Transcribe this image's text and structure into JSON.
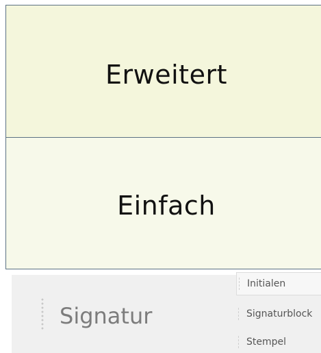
{
  "cards": {
    "advanced_label": "Erweitert",
    "simple_label": "Einfach"
  },
  "signature_panel": {
    "label": "Signatur",
    "menu": {
      "items": [
        "Initialen",
        "Signaturblock",
        "Stempel"
      ]
    }
  },
  "colors": {
    "advanced_bg": "#f4f6dc",
    "simple_bg": "#f7f9ea",
    "card_border": "#5b7183",
    "panel_bg": "#f0f0f0"
  }
}
